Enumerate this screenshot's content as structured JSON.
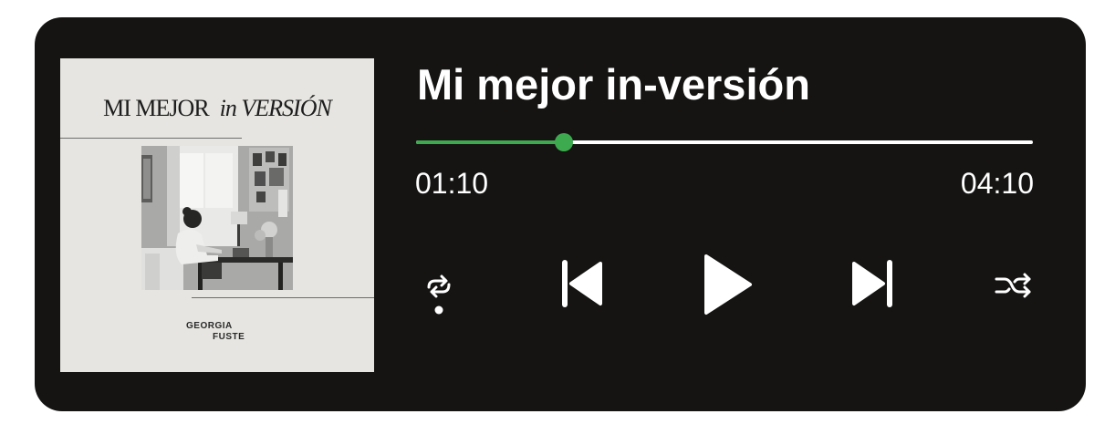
{
  "album": {
    "title_part1": "MI MEJOR",
    "title_part2": "in VERSIÓN",
    "artist_line1": "GEORGIA",
    "artist_line2": "FUSTE"
  },
  "track": {
    "title": "Mi mejor in-versión",
    "elapsed": "01:10",
    "duration": "04:10",
    "progress": 0.24
  },
  "controls": {
    "repeat_icon": "repeat-icon",
    "repeat_active": true,
    "prev_icon": "skip-previous-icon",
    "play_icon": "play-icon",
    "next_icon": "skip-next-icon",
    "shuffle_icon": "shuffle-icon"
  },
  "colors": {
    "background": "#151413",
    "accent": "#3eaa4f",
    "text": "#ffffff"
  }
}
